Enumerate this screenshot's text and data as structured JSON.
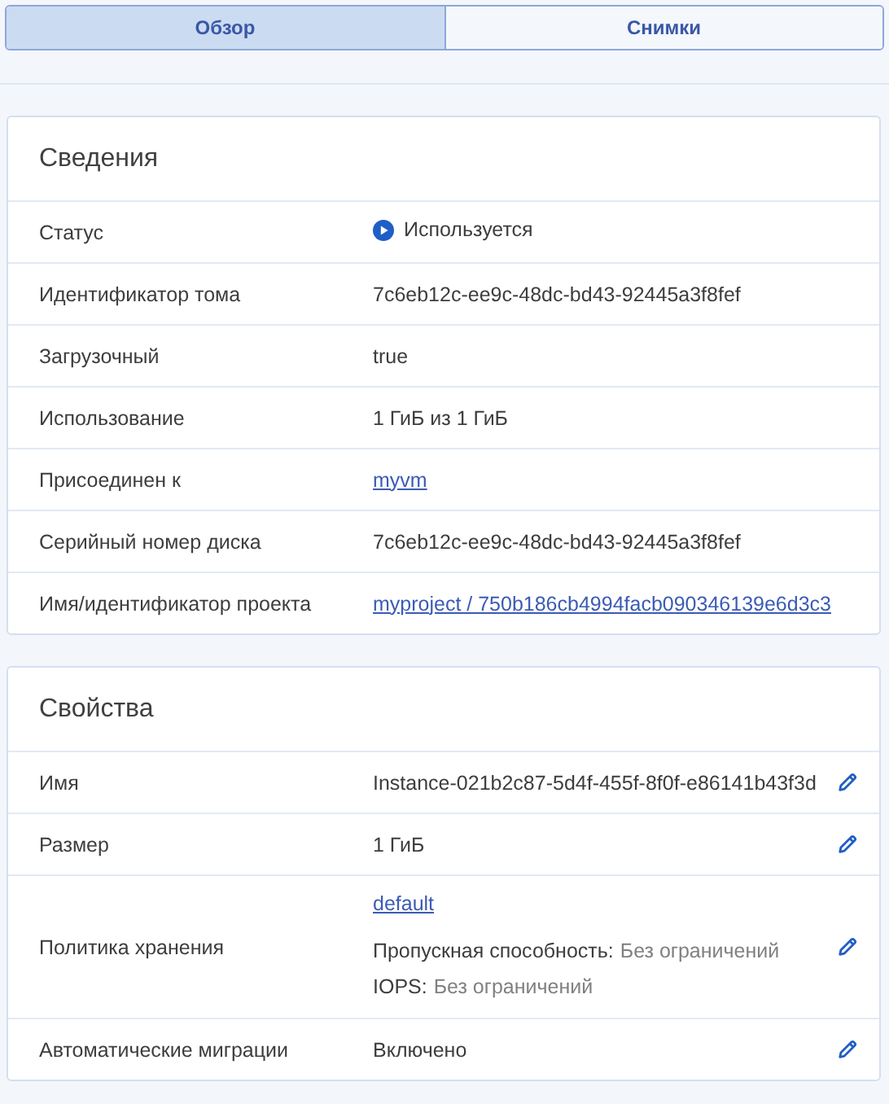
{
  "tabs": [
    {
      "label": "Обзор",
      "selected": true
    },
    {
      "label": "Снимки",
      "selected": false
    }
  ],
  "sections": [
    {
      "title": "Сведения",
      "rows": [
        {
          "label": "Статус",
          "kind": "status",
          "value": "Используется",
          "editable": false
        },
        {
          "label": "Идентификатор тома",
          "kind": "text",
          "value": "7c6eb12c-ee9c-48dc-bd43-92445a3f8fef",
          "editable": false
        },
        {
          "label": "Загрузочный",
          "kind": "text",
          "value": "true",
          "editable": false
        },
        {
          "label": "Использование",
          "kind": "text",
          "value": "1 ГиБ из 1 ГиБ",
          "editable": false
        },
        {
          "label": "Присоединен к",
          "kind": "link",
          "value": "myvm",
          "editable": false
        },
        {
          "label": "Серийный номер диска",
          "kind": "text",
          "value": "7c6eb12c-ee9c-48dc-bd43-92445a3f8fef",
          "editable": false
        },
        {
          "label": "Имя/идентификатор проекта",
          "kind": "link",
          "value": "myproject / 750b186cb4994facb090346139e6d3c3",
          "editable": false
        }
      ]
    },
    {
      "title": "Свойства",
      "rows": [
        {
          "label": "Имя",
          "kind": "text",
          "value": "Instance-021b2c87-5d4f-455f-8f0f-e86141b43f3d",
          "editable": true
        },
        {
          "label": "Размер",
          "kind": "text",
          "value": "1 ГиБ",
          "editable": true
        },
        {
          "label": "Политика хранения",
          "kind": "policy",
          "value": "default",
          "lines": [
            {
              "label": "Пропускная способность:",
              "value": "Без ограничений"
            },
            {
              "label": "IOPS:",
              "value": "Без ограничений"
            }
          ],
          "editable": true
        },
        {
          "label": "Автоматические миграции",
          "kind": "text",
          "value": "Включено",
          "editable": true
        }
      ]
    }
  ]
}
